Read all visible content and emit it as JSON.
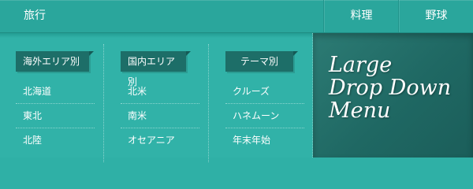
{
  "nav": {
    "travel": "旅行",
    "cooking": "料理",
    "baseball": "野球"
  },
  "dropdown": {
    "columns": [
      {
        "heading": "海外エリア別",
        "items": [
          "北海道",
          "東北",
          "北陸"
        ]
      },
      {
        "heading": "国内エリア別",
        "items": [
          "北米",
          "南米",
          "オセアニア"
        ]
      },
      {
        "heading": "テーマ別",
        "items": [
          "クルーズ",
          "ハネムーン",
          "年末年始"
        ]
      }
    ]
  },
  "promo": {
    "lines": [
      "Large",
      "Drop Down",
      "Menu"
    ]
  },
  "colors": {
    "background": "#2fb0a6",
    "heading_tab": "#1d6e68",
    "promo_panel": "#1f6863"
  }
}
